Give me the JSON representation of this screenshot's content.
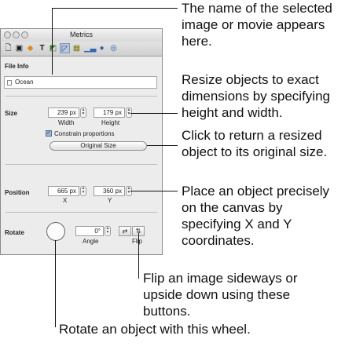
{
  "window": {
    "title": "Metrics"
  },
  "toolbar": {
    "icons": [
      "document-icon",
      "image-icon",
      "shape-icon",
      "text-icon",
      "graphic-icon",
      "metrics-icon",
      "table-icon",
      "chart-icon",
      "link-icon",
      "search-icon"
    ]
  },
  "file_info": {
    "label": "File Info",
    "name": "Ocean"
  },
  "size": {
    "label": "Size",
    "width_value": "239 px",
    "height_value": "179 px",
    "width_label": "Width",
    "height_label": "Height",
    "constrain_label": "Constrain proportions",
    "original_size_label": "Original Size"
  },
  "position": {
    "label": "Position",
    "x_value": "665 px",
    "y_value": "360 px",
    "x_label": "X",
    "y_label": "Y"
  },
  "rotate": {
    "label": "Rotate",
    "angle_value": "0°",
    "angle_label": "Angle",
    "flip_label": "Flip"
  },
  "callouts": {
    "name_lines": [
      "The name of the selected",
      "image or movie appears",
      "here."
    ],
    "resize_lines": [
      "Resize objects to exact",
      "dimensions by specifying",
      "height and width."
    ],
    "original_lines": [
      "Click to return a resized",
      "object to its original size."
    ],
    "position_lines": [
      "Place an object precisely",
      "on the canvas by",
      "specifying X and Y",
      "coordinates."
    ],
    "flip_lines": [
      "Flip an image sideways or",
      "upside down using these",
      "buttons."
    ],
    "rotate_line": "Rotate an object with this wheel."
  }
}
